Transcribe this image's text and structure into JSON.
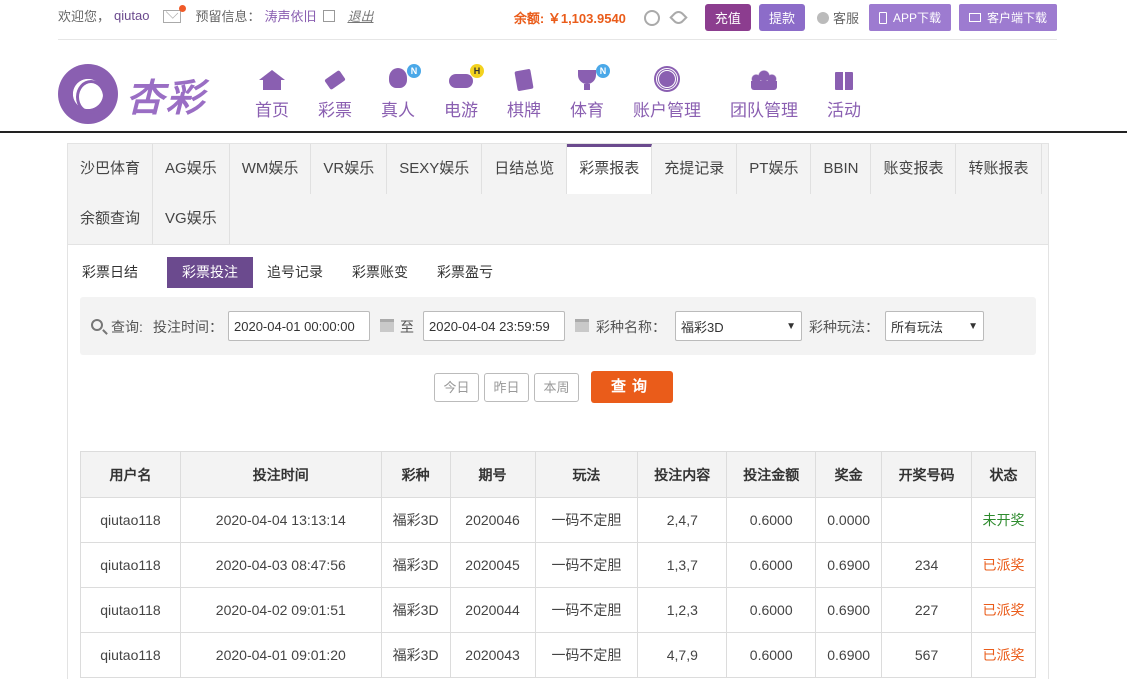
{
  "topbar": {
    "welcome": "欢迎您，",
    "username": "qiutao",
    "reserved_label": "预留信息：",
    "reserved_value": "涛声依旧",
    "logout": "退出",
    "balance_label": "余额:",
    "balance_value": "￥1,103.9540",
    "deposit": "充值",
    "withdraw": "提款",
    "service": "客服",
    "app_download": "APP下载",
    "client_download": "客户端下载"
  },
  "brand": {
    "logo_text": "杏彩"
  },
  "nav": [
    {
      "label": "首页",
      "icon": "home-icon",
      "badge": ""
    },
    {
      "label": "彩票",
      "icon": "lottery-ticket-icon",
      "badge": ""
    },
    {
      "label": "真人",
      "icon": "live-dealer-icon",
      "badge": "N"
    },
    {
      "label": "电游",
      "icon": "gamepad-icon",
      "badge": "H"
    },
    {
      "label": "棋牌",
      "icon": "cards-icon",
      "badge": ""
    },
    {
      "label": "体育",
      "icon": "trophy-icon",
      "badge": "N"
    },
    {
      "label": "账户管理",
      "icon": "coin-icon",
      "badge": ""
    },
    {
      "label": "团队管理",
      "icon": "team-icon",
      "badge": ""
    },
    {
      "label": "活动",
      "icon": "gift-icon",
      "badge": ""
    }
  ],
  "report_tabs": [
    "沙巴体育",
    "AG娱乐",
    "WM娱乐",
    "VR娱乐",
    "SEXY娱乐",
    "日结总览",
    "彩票报表",
    "充提记录",
    "PT娱乐",
    "BBIN",
    "账变报表",
    "转账报表",
    "余额查询",
    "VG娱乐"
  ],
  "active_report_tab": "彩票报表",
  "sub_tabs": [
    "彩票日结",
    "彩票投注",
    "追号记录",
    "彩票账变",
    "彩票盈亏"
  ],
  "active_sub_tab": "彩票投注",
  "filter": {
    "query_label": "查询:",
    "time_label": "投注时间：",
    "start": "2020-04-01 00:00:00",
    "to": "至",
    "end": "2020-04-04 23:59:59",
    "lottery_label": "彩种名称：",
    "lottery_value": "福彩3D",
    "play_label": "彩种玩法：",
    "play_value": "所有玩法"
  },
  "quick": {
    "today": "今日",
    "yesterday": "昨日",
    "this_week": "本周",
    "query": "查询"
  },
  "table": {
    "headers": [
      "用户名",
      "投注时间",
      "彩种",
      "期号",
      "玩法",
      "投注内容",
      "投注金额",
      "奖金",
      "开奖号码",
      "状态"
    ],
    "rows": [
      [
        "qiutao118",
        "2020-04-04 13:13:14",
        "福彩3D",
        "2020046",
        "一码不定胆",
        "2,4,7",
        "0.6000",
        "0.0000",
        "",
        "未开奖"
      ],
      [
        "qiutao118",
        "2020-04-03 08:47:56",
        "福彩3D",
        "2020045",
        "一码不定胆",
        "1,3,7",
        "0.6000",
        "0.6900",
        "234",
        "已派奖"
      ],
      [
        "qiutao118",
        "2020-04-02 09:01:51",
        "福彩3D",
        "2020044",
        "一码不定胆",
        "1,2,3",
        "0.6000",
        "0.6900",
        "227",
        "已派奖"
      ],
      [
        "qiutao118",
        "2020-04-01 09:01:20",
        "福彩3D",
        "2020043",
        "一码不定胆",
        "4,7,9",
        "0.6000",
        "0.6900",
        "567",
        "已派奖"
      ]
    ]
  },
  "colors": {
    "brand_purple": "#6b4a8e",
    "accent_orange": "#ea5c1a",
    "pending_green": "#2e8b2e"
  }
}
